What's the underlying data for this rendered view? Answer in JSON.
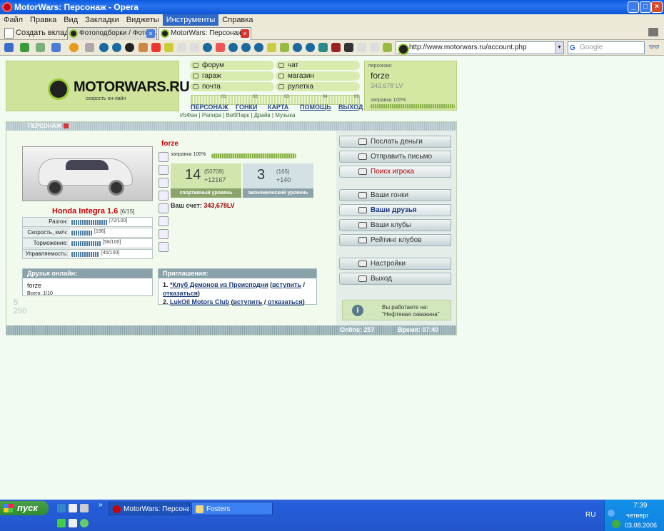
{
  "window": {
    "title": "MotorWars: Персонаж - Opera"
  },
  "menu": [
    "Файл",
    "Правка",
    "Вид",
    "Закладки",
    "Виджеты",
    "Инструменты",
    "Справка"
  ],
  "tabs": {
    "new_tab": "Создать вкладку",
    "items": [
      "Фотоподборки / Фотоп...",
      "MotorWars: Персонаж"
    ]
  },
  "toolbar": {
    "address": "http://www.motorwars.ru/account.php",
    "search_placeholder": "Google",
    "search_letter": "G"
  },
  "logo": {
    "name": "MOTORWARS.RU",
    "tagline": "скорость он-лайн"
  },
  "nav": {
    "items": [
      "форум",
      "чат",
      "гараж",
      "магазин",
      "почта",
      "рулетка"
    ],
    "scale": [
      "01",
      "02",
      "03",
      "04",
      "05"
    ],
    "main_links": [
      "ПЕРСОНАЖ",
      "ГОНКИ",
      "КАРТА",
      "ПОМОЩЬ",
      "ВЫХОД"
    ],
    "sub_links": [
      "ИзФан",
      "Рапира",
      "ВебПарк",
      "Драйв",
      "Музыка"
    ]
  },
  "profile_box": {
    "label": "персонаж:",
    "name": "forze",
    "lv": "343,678 LV",
    "fuel_label": "заправка 100%",
    "fuel_percent": 100
  },
  "panel": {
    "title": "ПЕРСОНАЖ",
    "player_name": "forze",
    "fuel_label": "заправка 100%",
    "fuel_percent": 100,
    "car": {
      "name": "Honda Integra 1.6",
      "slot": "[6/15]"
    },
    "stats": [
      {
        "label": "Разгон:",
        "value": "[72/100]",
        "fraction": 0.72
      },
      {
        "label": "Скорость, км/ч:",
        "value": "[196]",
        "fraction": 0.42
      },
      {
        "label": "Торможение:",
        "value": "[58/100]",
        "fraction": 0.58
      },
      {
        "label": "Управляемость:",
        "value": "[45/100]",
        "fraction": 0.55
      }
    ],
    "sport_level": {
      "level": "14",
      "points": "(50709)",
      "delta": "+12167",
      "label": "спортивный уровень"
    },
    "econ_level": {
      "level": "3",
      "points": "(165)",
      "delta": "+140",
      "label": "экономический уровень"
    },
    "account": {
      "label": "Ваш счет:",
      "value": "343,678LV"
    },
    "friends": {
      "title": "Друзья онлайн:",
      "name": "forze",
      "total": "Всего: 1/10"
    },
    "invites": {
      "title": "Приглашения:",
      "items": [
        {
          "num": "1.",
          "club": "*Клуб Демонов из Преисподни",
          "accept": "вступить",
          "decline": "отказаться"
        },
        {
          "num": "2.",
          "club": "LukOil Motors Club",
          "accept": "вступить",
          "decline": "отказаться"
        }
      ]
    },
    "buttons": [
      "Послать деньги",
      "Отправить письмо",
      "Поиск игрока",
      "Ваши гонки",
      "Ваши друзья",
      "Ваши клубы",
      "Рейтинг клубов",
      "Настройки",
      "Выход"
    ],
    "work": {
      "line1": "Вы работаете на:",
      "line2": "\"Нефтяная скважина\""
    },
    "bg_numbers": [
      "5",
      "250"
    ],
    "footer": {
      "online": "Online: 257",
      "time": "Время: 07:40"
    }
  },
  "taskbar": {
    "start": "пуск",
    "windows": [
      "MotorWars: Персона...",
      "Fosters"
    ],
    "lang": "RU",
    "time": "7:39",
    "day": "четверг",
    "date": "03.08.2006"
  }
}
